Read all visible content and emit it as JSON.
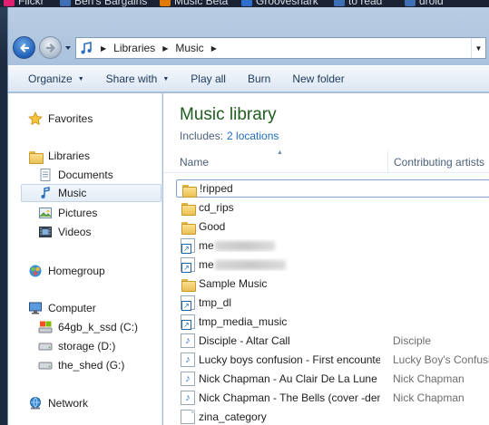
{
  "bookmarks": [
    {
      "label": "Flickr",
      "color": "#e0206e"
    },
    {
      "label": "Ben's Bargains",
      "color": "#3c6fb4"
    },
    {
      "label": "Music Beta",
      "color": "#e07b00"
    },
    {
      "label": "Grooveshark",
      "color": "#2f6fd0"
    },
    {
      "label": "to read",
      "color": "#3c6fb4"
    },
    {
      "label": "droid",
      "color": "#3c6fb4"
    }
  ],
  "address": {
    "segments": [
      "Libraries",
      "Music"
    ]
  },
  "toolbar": {
    "organize": "Organize",
    "share_with": "Share with",
    "play_all": "Play all",
    "burn": "Burn",
    "new_folder": "New folder"
  },
  "nav": {
    "favorites": "Favorites",
    "libraries": "Libraries",
    "documents": "Documents",
    "music": "Music",
    "pictures": "Pictures",
    "videos": "Videos",
    "homegroup": "Homegroup",
    "computer": "Computer",
    "drive_c": "64gb_k_ssd (C:)",
    "drive_d": "storage (D:)",
    "drive_g": "the_shed (G:)",
    "network": "Network"
  },
  "library": {
    "title": "Music library",
    "includes_label": "Includes:",
    "locations_link": "2 locations"
  },
  "columns": {
    "name": "Name",
    "artists": "Contributing artists"
  },
  "files": [
    {
      "name": "!ripped",
      "artist": "",
      "type": "folder"
    },
    {
      "name": "cd_rips",
      "artist": "",
      "type": "folder"
    },
    {
      "name": "Good",
      "artist": "",
      "type": "folder"
    },
    {
      "name": "me",
      "artist": "",
      "type": "shortcut",
      "redacted": true
    },
    {
      "name": "me",
      "artist": "",
      "type": "shortcut",
      "redacted": true
    },
    {
      "name": "Sample Music",
      "artist": "",
      "type": "folder"
    },
    {
      "name": "tmp_dl",
      "artist": "",
      "type": "shortcut"
    },
    {
      "name": "tmp_media_music",
      "artist": "",
      "type": "shortcut"
    },
    {
      "name": "Disciple - Altar Call",
      "artist": "Disciple",
      "type": "music"
    },
    {
      "name": "Lucky boys confusion - First encounter",
      "artist": "Lucky Boy's Confusion",
      "type": "music"
    },
    {
      "name": "Nick Chapman - Au Clair De La Lune",
      "artist": "Nick Chapman",
      "type": "music"
    },
    {
      "name": "Nick Chapman - The Bells (cover -demo)",
      "artist": "Nick Chapman",
      "type": "music"
    },
    {
      "name": "zina_category",
      "artist": "",
      "type": "file"
    }
  ]
}
